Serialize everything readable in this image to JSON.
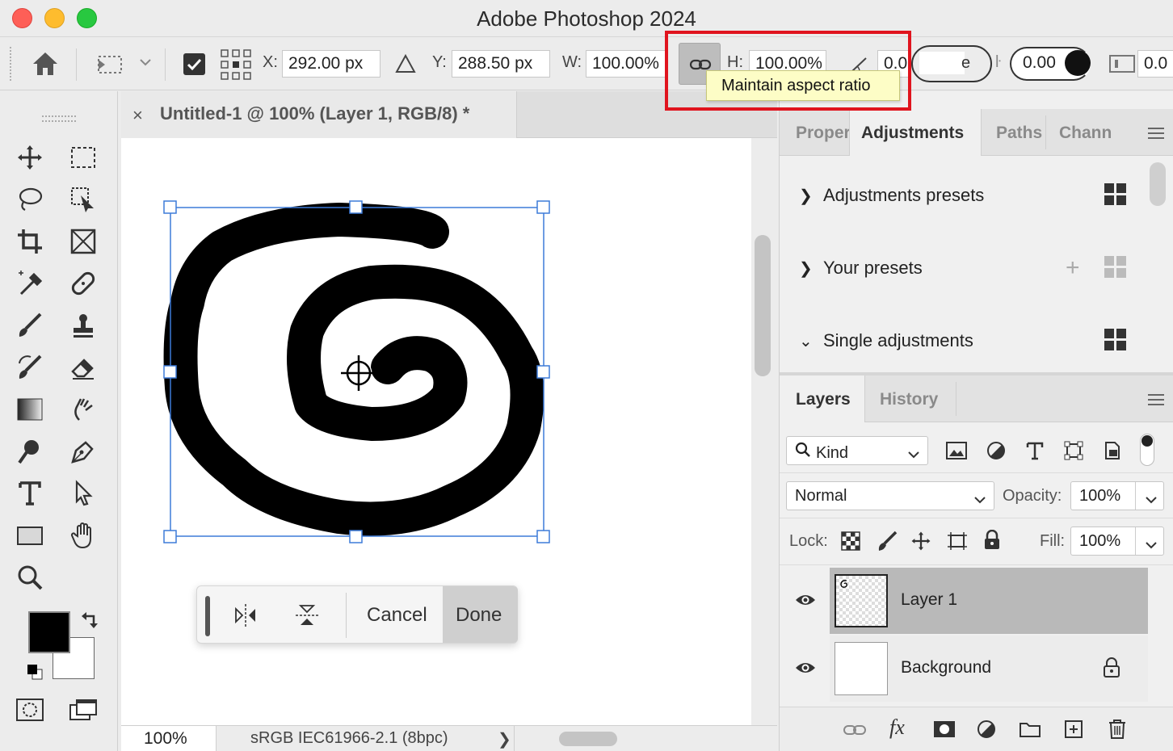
{
  "window": {
    "title": "Adobe Photoshop 2024"
  },
  "options_bar": {
    "x_label": "X:",
    "x_value": "292.00 px",
    "y_label": "Y:",
    "y_value": "288.50 px",
    "w_label": "W:",
    "w_value": "100.00%",
    "h_label": "H:",
    "h_value": "100.00%",
    "angle_value": "0.0",
    "interp_partial": "e",
    "hskew_value": "0.00",
    "vskew_value": "0.0",
    "tooltip": "Maintain aspect ratio"
  },
  "document": {
    "tab_title": "Untitled-1 @ 100% (Layer 1, RGB/8) *",
    "zoom": "100%",
    "color_profile": "sRGB IEC61966-2.1 (8bpc)"
  },
  "transform_bar": {
    "cancel_label": "Cancel",
    "done_label": "Done"
  },
  "panels": {
    "top_tabs": [
      "Proper",
      "Adjustments",
      "Paths",
      "Chann"
    ],
    "adjustments": {
      "presets": "Adjustments presets",
      "your_presets": "Your presets",
      "single": "Single adjustments"
    },
    "layers_tabs": [
      "Layers",
      "History"
    ],
    "filter_kind": "Kind",
    "blend_mode": "Normal",
    "opacity_label": "Opacity:",
    "opacity_value": "100%",
    "lock_label": "Lock:",
    "fill_label": "Fill:",
    "fill_value": "100%",
    "layers": [
      {
        "name": "Layer 1",
        "selected": true
      },
      {
        "name": "Background",
        "locked": true
      }
    ]
  },
  "colors": {
    "accent_blue": "#3d7bd8",
    "highlight_red": "#e0141e",
    "tooltip_bg": "#fdfdc6",
    "selected_layer": "#b9b9b9"
  }
}
